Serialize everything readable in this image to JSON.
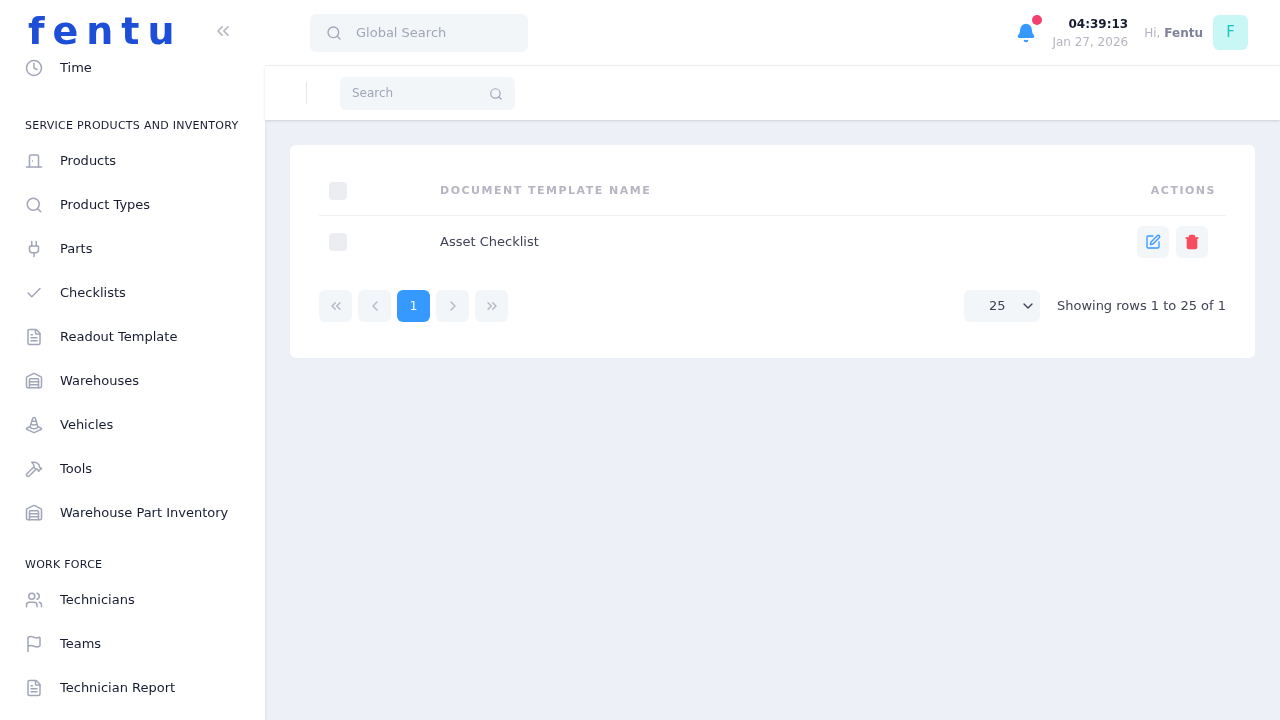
{
  "logo": "fentu",
  "sidebar": {
    "sections": [
      {
        "items": [
          {
            "label": "Time"
          }
        ]
      },
      {
        "heading": "SERVICE PRODUCTS AND INVENTORY",
        "items": [
          {
            "label": "Products"
          },
          {
            "label": "Product Types"
          },
          {
            "label": "Parts"
          },
          {
            "label": "Checklists"
          },
          {
            "label": "Readout Template"
          },
          {
            "label": "Warehouses"
          },
          {
            "label": "Vehicles"
          },
          {
            "label": "Tools"
          },
          {
            "label": "Warehouse Part Inventory"
          }
        ]
      },
      {
        "heading": "WORK FORCE",
        "items": [
          {
            "label": "Technicians"
          },
          {
            "label": "Teams"
          },
          {
            "label": "Technician Report"
          }
        ]
      }
    ]
  },
  "header": {
    "search_placeholder": "Global Search",
    "time": "04:39:13",
    "date": "Jan 27, 2026",
    "greeting": "Hi,",
    "user": "Fentu",
    "avatar": "F",
    "notification_unread": true
  },
  "toolbar": {
    "search_placeholder": "Search"
  },
  "table": {
    "columns": [
      "DOCUMENT TEMPLATE NAME",
      "ACTIONS"
    ],
    "rows": [
      {
        "name": "Asset Checklist",
        "checked": false
      }
    ],
    "all_checked": false
  },
  "pagination": {
    "pages": [
      {
        "label": "1",
        "selected": true
      }
    ],
    "page_size": "25",
    "summary": "Showing rows 1 to 25 of 1"
  }
}
